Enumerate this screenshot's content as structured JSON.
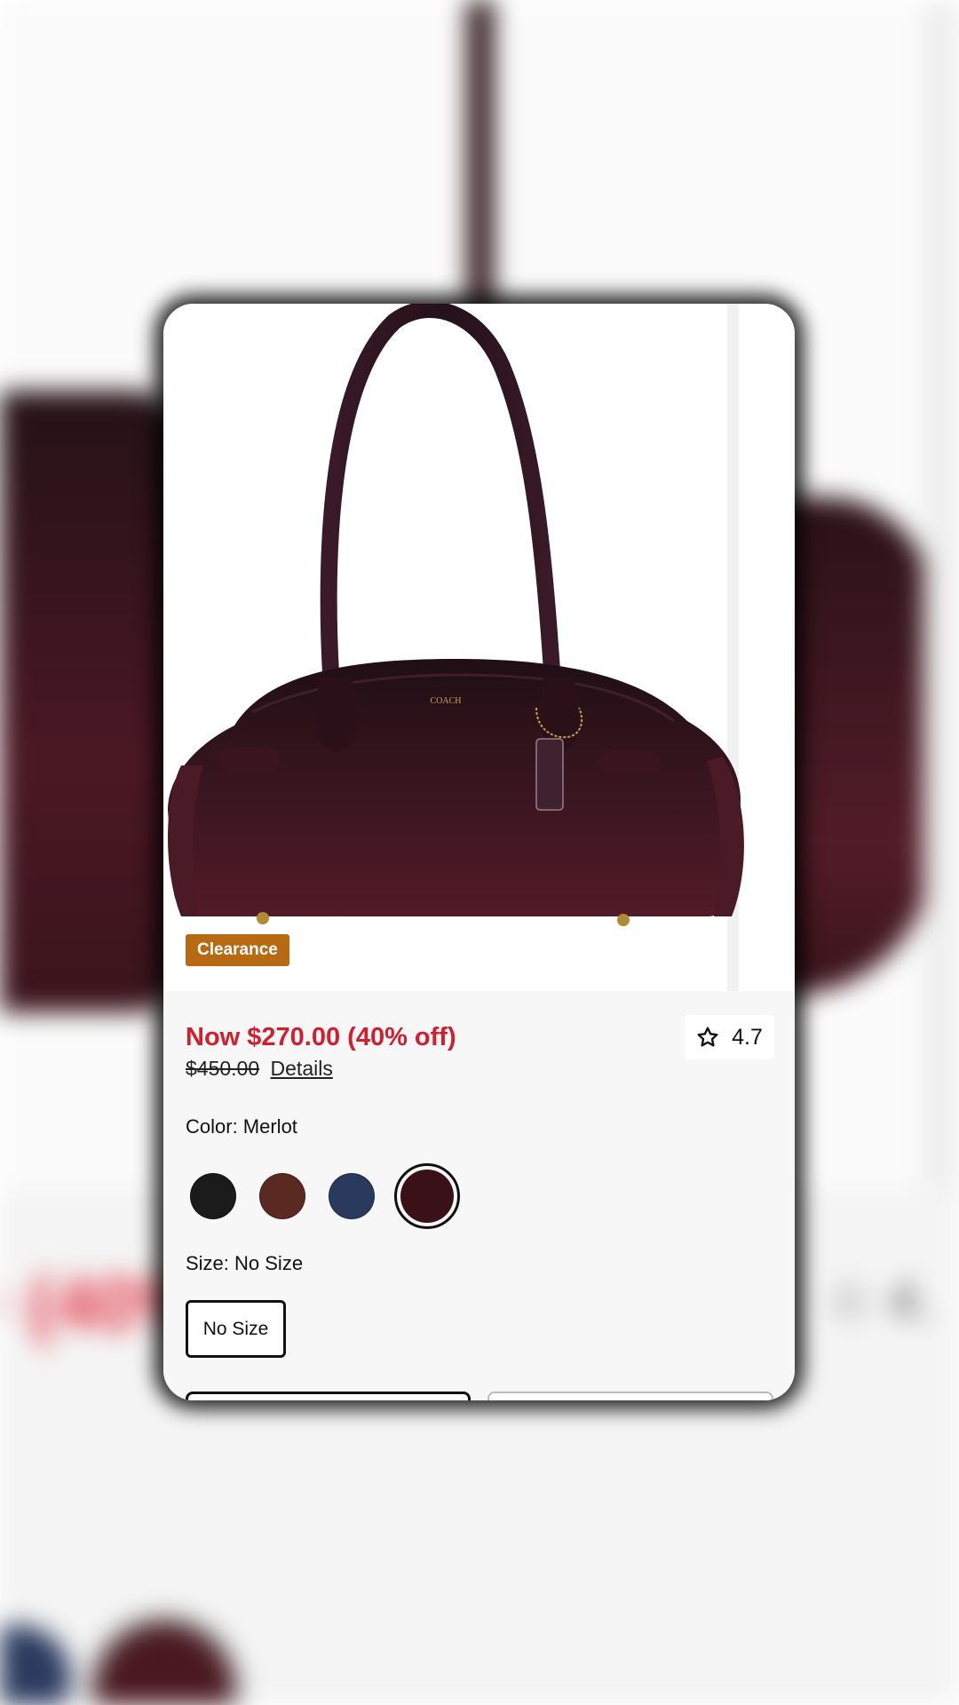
{
  "product": {
    "badge": "Clearance",
    "price_now": "Now $270.00 (40% off)",
    "price_was": "$450.00",
    "details_link": "Details",
    "rating": "4.7",
    "brand_mark": "COACH"
  },
  "color": {
    "label": "Color: Merlot",
    "swatches": [
      {
        "name": "black",
        "color": "#1b1b1b"
      },
      {
        "name": "brown",
        "color": "#5a2a22"
      },
      {
        "name": "navy",
        "color": "#2a3a5c"
      },
      {
        "name": "merlot",
        "color": "#3a1118",
        "selected": true
      }
    ]
  },
  "size": {
    "label": "Size: No Size",
    "option": "No Size"
  },
  "background": {
    "price_fragment": "0 (40%",
    "rating_fragment": "4."
  },
  "colors": {
    "sale_red": "#d0202f",
    "badge_orange": "#b86a12"
  }
}
